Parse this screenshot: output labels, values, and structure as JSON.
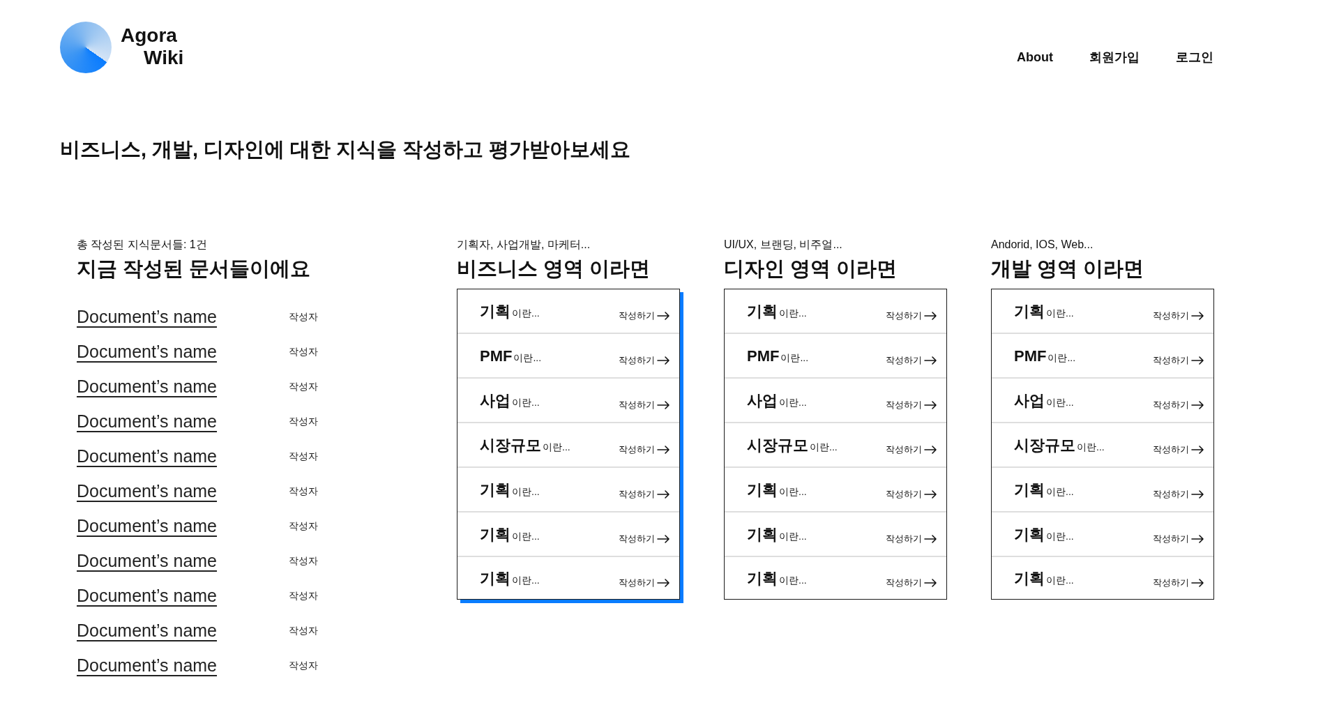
{
  "header": {
    "logo": {
      "line_1": "Agora",
      "line_2": "Wiki"
    },
    "nav": [
      "About",
      "회원가입",
      "로그인"
    ]
  },
  "headline": "비즈니스, 개발, 디자인에 대한 지식을 작성하고 평가받아보세요",
  "documents": {
    "count_label": "총 작성된 지식문서들: 1건",
    "title": "지금 작성된 문서들이에요",
    "items": [
      {
        "name": "Document’s name",
        "author": "작성자"
      },
      {
        "name": "Document’s name",
        "author": "작성자"
      },
      {
        "name": "Document’s name",
        "author": "작성자"
      },
      {
        "name": "Document’s name",
        "author": "작성자"
      },
      {
        "name": "Document’s name",
        "author": "작성자"
      },
      {
        "name": "Document’s name",
        "author": "작성자"
      },
      {
        "name": "Document’s name",
        "author": "작성자"
      },
      {
        "name": "Document’s name",
        "author": "작성자"
      },
      {
        "name": "Document’s name",
        "author": "작성자"
      },
      {
        "name": "Document’s name",
        "author": "작성자"
      },
      {
        "name": "Document’s name",
        "author": "작성자"
      }
    ]
  },
  "categories": [
    {
      "subtitle": "기획자, 사업개발, 마케터...",
      "title": "비즈니스 영역 이라면",
      "selected": true,
      "topics": [
        {
          "term": "기획",
          "suffix": "이란...",
          "action": "작성하기"
        },
        {
          "term": "PMF",
          "suffix": "이란...",
          "action": "작성하기"
        },
        {
          "term": "사업",
          "suffix": "이란...",
          "action": "작성하기"
        },
        {
          "term": "시장규모",
          "suffix": "이란...",
          "action": "작성하기"
        },
        {
          "term": "기획",
          "suffix": "이란...",
          "action": "작성하기"
        },
        {
          "term": "기획",
          "suffix": "이란...",
          "action": "작성하기"
        },
        {
          "term": "기획",
          "suffix": "이란...",
          "action": "작성하기"
        }
      ]
    },
    {
      "subtitle": "UI/UX, 브랜딩, 비주얼...",
      "title": "디자인 영역 이라면",
      "selected": false,
      "topics": [
        {
          "term": "기획",
          "suffix": "이란...",
          "action": "작성하기"
        },
        {
          "term": "PMF",
          "suffix": "이란...",
          "action": "작성하기"
        },
        {
          "term": "사업",
          "suffix": "이란...",
          "action": "작성하기"
        },
        {
          "term": "시장규모",
          "suffix": "이란...",
          "action": "작성하기"
        },
        {
          "term": "기획",
          "suffix": "이란...",
          "action": "작성하기"
        },
        {
          "term": "기획",
          "suffix": "이란...",
          "action": "작성하기"
        },
        {
          "term": "기획",
          "suffix": "이란...",
          "action": "작성하기"
        }
      ]
    },
    {
      "subtitle": "Andorid, IOS, Web...",
      "title": "개발 영역 이라면",
      "selected": false,
      "topics": [
        {
          "term": "기획",
          "suffix": "이란...",
          "action": "작성하기"
        },
        {
          "term": "PMF",
          "suffix": "이란...",
          "action": "작성하기"
        },
        {
          "term": "사업",
          "suffix": "이란...",
          "action": "작성하기"
        },
        {
          "term": "시장규모",
          "suffix": "이란...",
          "action": "작성하기"
        },
        {
          "term": "기획",
          "suffix": "이란...",
          "action": "작성하기"
        },
        {
          "term": "기획",
          "suffix": "이란...",
          "action": "작성하기"
        },
        {
          "term": "기획",
          "suffix": "이란...",
          "action": "작성하기"
        }
      ]
    }
  ]
}
